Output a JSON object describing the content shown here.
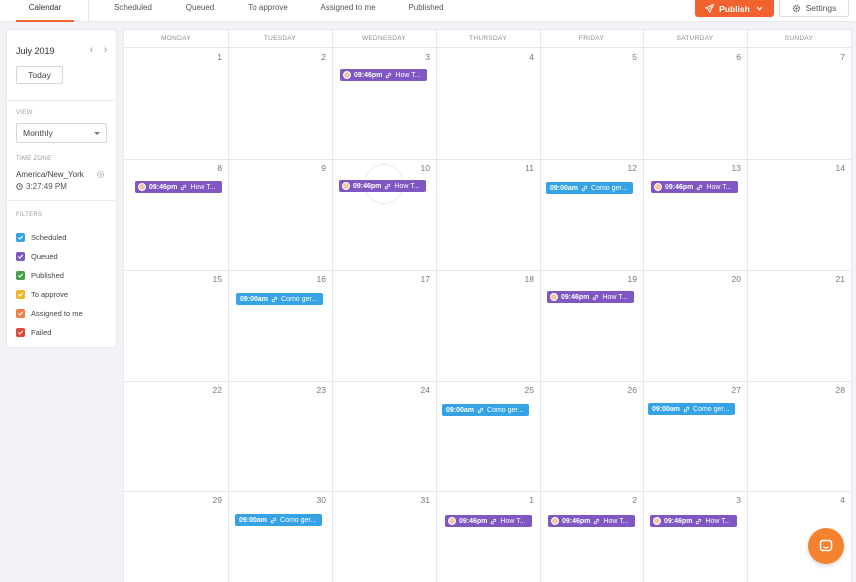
{
  "tabs": [
    {
      "label": "Calendar",
      "active": true
    },
    {
      "label": "Scheduled"
    },
    {
      "label": "Queued"
    },
    {
      "label": "To approve"
    },
    {
      "label": "Assigned to me"
    },
    {
      "label": "Published"
    }
  ],
  "actions": {
    "publish_label": "Publish",
    "settings_label": "Settings"
  },
  "sidebar": {
    "month_label": "July 2019",
    "today_label": "Today",
    "view_label": "VIEW",
    "view_value": "Monthly",
    "timezone_label": "TIME ZONE",
    "timezone_name": "America/New_York",
    "timezone_time": "3:27:49 PM",
    "filters_label": "FILTERS",
    "filters": [
      {
        "label": "Scheduled",
        "color": "#36a3e6"
      },
      {
        "label": "Queued",
        "color": "#7e57c2"
      },
      {
        "label": "Published",
        "color": "#43a047"
      },
      {
        "label": "To approve",
        "color": "#f0b429"
      },
      {
        "label": "Assigned to me",
        "color": "#ef7d45"
      },
      {
        "label": "Failed",
        "color": "#e0453a"
      }
    ]
  },
  "calendar": {
    "weekdays": [
      "MONDAY",
      "TUESDAY",
      "WEDNESDAY",
      "THURSDAY",
      "FRIDAY",
      "SATURDAY",
      "SUNDAY"
    ],
    "days": [
      "1",
      "2",
      "3",
      "4",
      "5",
      "6",
      "7",
      "8",
      "9",
      "10",
      "11",
      "12",
      "13",
      "14",
      "15",
      "16",
      "17",
      "18",
      "19",
      "20",
      "21",
      "22",
      "23",
      "24",
      "25",
      "26",
      "27",
      "28",
      "29",
      "30",
      "31",
      "1",
      "2",
      "3",
      "4"
    ],
    "events": [
      {
        "time": "09:46pm",
        "title": "How T...",
        "status": "queued"
      },
      {
        "time": "09:46pm",
        "title": "How T...",
        "status": "queued"
      },
      {
        "time": "09:46pm",
        "title": "How T...",
        "status": "queued"
      },
      {
        "time": "09:00am",
        "title": "Como ger...",
        "status": "scheduled"
      },
      {
        "time": "09:46pm",
        "title": "How T...",
        "status": "queued"
      },
      {
        "time": "09:00am",
        "title": "Como ger...",
        "status": "scheduled"
      },
      {
        "time": "09:46pm",
        "title": "How T...",
        "status": "queued"
      },
      {
        "time": "09:00am",
        "title": "Como ger...",
        "status": "scheduled"
      },
      {
        "time": "09:00am",
        "title": "Como ger...",
        "status": "scheduled"
      },
      {
        "time": "09:00am",
        "title": "Como ger...",
        "status": "scheduled"
      },
      {
        "time": "09:46pm",
        "title": "How T...",
        "status": "queued"
      },
      {
        "time": "09:46pm",
        "title": "How T...",
        "status": "queued"
      },
      {
        "time": "09:46pm",
        "title": "How T...",
        "status": "queued"
      }
    ]
  },
  "colors": {
    "accent": "#f2622e",
    "queued": "#7e57c2",
    "scheduled": "#36a3e6",
    "chat": "#f4822e"
  }
}
